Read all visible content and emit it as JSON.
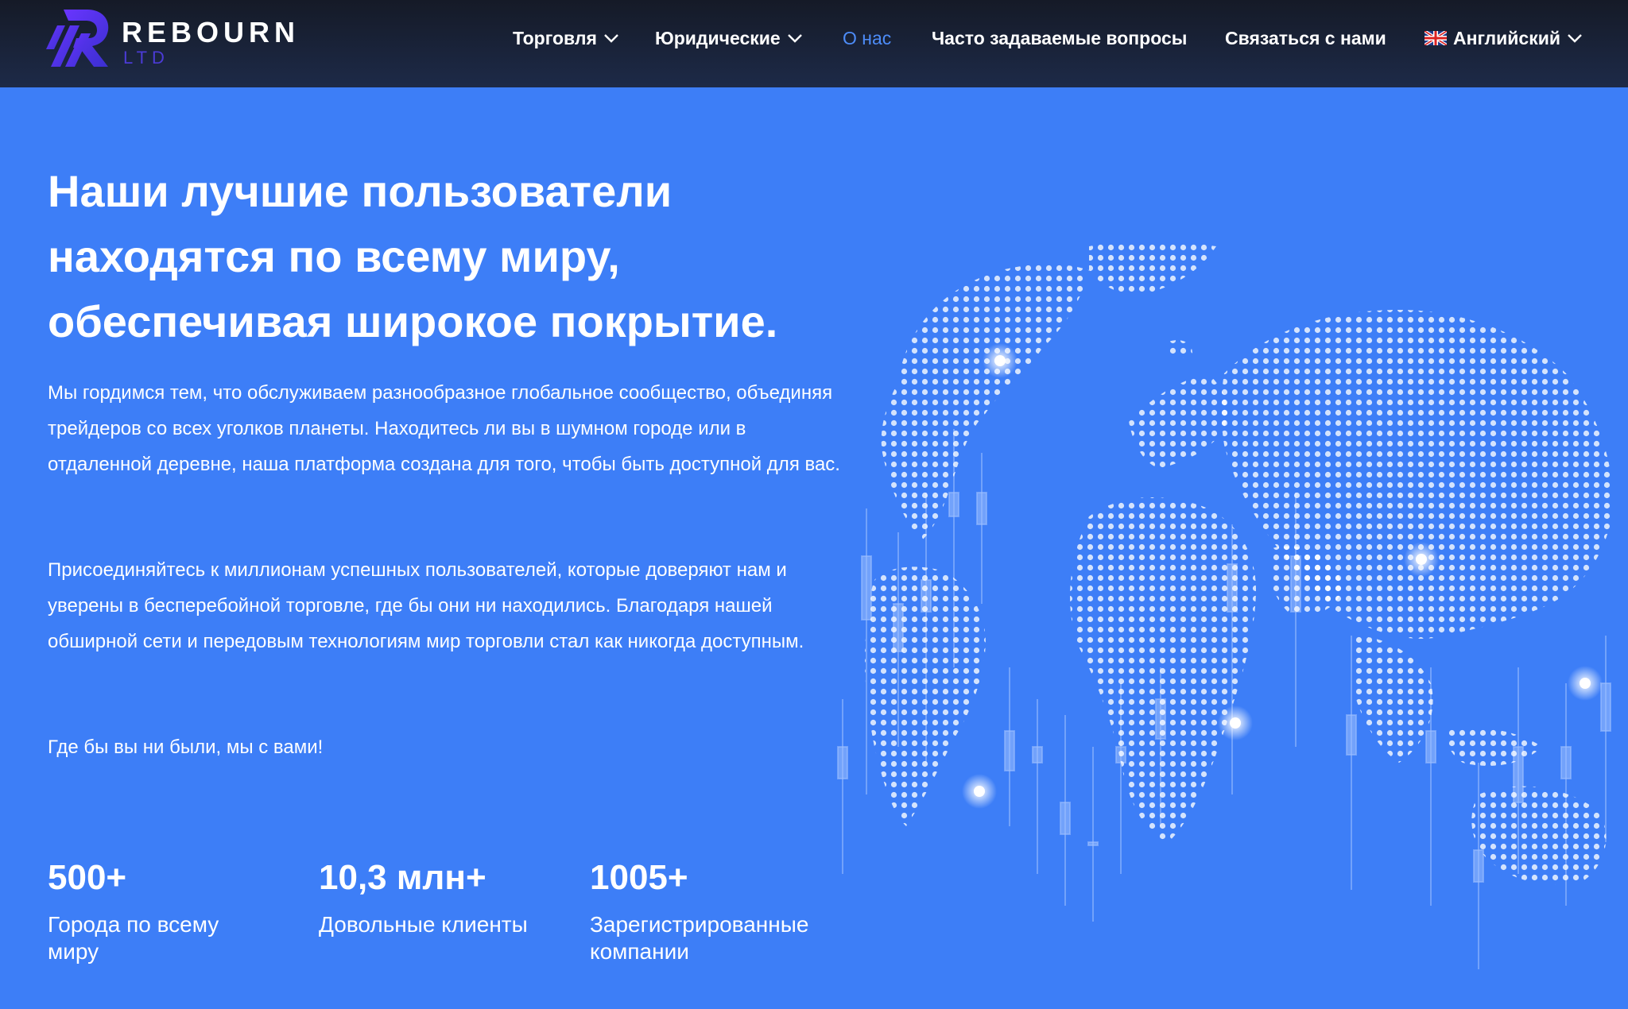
{
  "header": {
    "logo": {
      "name": "REBOURN",
      "sub": "LTD"
    },
    "nav": [
      {
        "label": "Торговля",
        "dropdown": true,
        "active": false
      },
      {
        "label": "Юридические",
        "dropdown": true,
        "active": false
      },
      {
        "label": "О нас",
        "dropdown": false,
        "active": true
      },
      {
        "label": "Часто задаваемые вопросы",
        "dropdown": false,
        "active": false
      },
      {
        "label": "Связаться с нами",
        "dropdown": false,
        "active": false
      },
      {
        "label": "Английский",
        "dropdown": true,
        "active": false,
        "icon": "uk-flag-icon"
      }
    ]
  },
  "hero": {
    "title": "Наши лучшие пользователи находятся по всему миру, обеспечивая широкое покрытие.",
    "paragraph1": "Мы гордимся тем, что обслуживаем разнообразное глобальное сообщество, объединяя трейдеров со всех уголков планеты. Находитесь ли вы в шумном городе или в отдаленной деревне, наша платформа создана для того, чтобы быть доступной для вас.",
    "paragraph2": "Присоединяйтесь к миллионам успешных пользователей, которые доверяют нам и уверены в бесперебойной торговле, где бы они ни находились. Благодаря нашей обширной сети и передовым технологиям мир торговли стал как никогда доступным.",
    "paragraph3": "Где бы вы ни были, мы с вами!"
  },
  "stats": [
    {
      "value": "500+",
      "label": "Города по всему миру"
    },
    {
      "value": "10,3 млн+",
      "label": "Довольные клиенты"
    },
    {
      "value": "1005+",
      "label": "Зарегистрированные компании"
    }
  ],
  "colors": {
    "background": "#3d7ef7",
    "header": "#1a2238",
    "active_link": "#4d8cf8",
    "logo_accent": "#4b3bd6"
  }
}
